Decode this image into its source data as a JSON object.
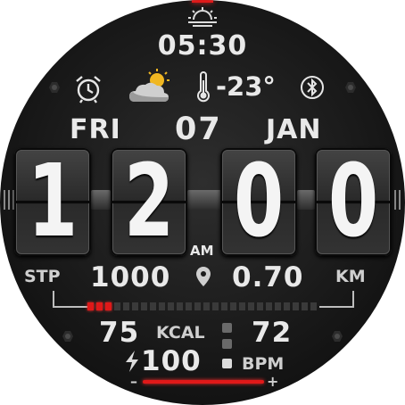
{
  "sunrise": {
    "icon": "sunrise-icon",
    "time": "05:30"
  },
  "status_row": {
    "alarm_icon": "alarm-clock-icon",
    "weather_icon": "partly-cloudy-icon",
    "thermometer_icon": "thermometer-icon",
    "temperature": "-23°",
    "bluetooth_icon": "bluetooth-icon"
  },
  "date": {
    "weekday": "FRI",
    "day": "07",
    "month": "JAN"
  },
  "time": {
    "h1": "1",
    "h2": "2",
    "m1": "0",
    "m2": "0",
    "ampm": "AM"
  },
  "activity": {
    "steps_label": "STP",
    "steps": "1000",
    "location_icon": "location-pin-icon",
    "distance": "0.70",
    "distance_unit": "KM",
    "progress_fraction": 0.1
  },
  "health": {
    "calories": "75",
    "calories_label": "KCAL",
    "heart_rate": "72",
    "heart_rate_label": "BPM",
    "battery_icon": "lightning-icon",
    "battery": "100",
    "battery_minus": "–",
    "battery_plus": "+"
  },
  "colors": {
    "accent": "#e01919",
    "background": "#1b1b1b",
    "text": "#e9e9e9"
  }
}
